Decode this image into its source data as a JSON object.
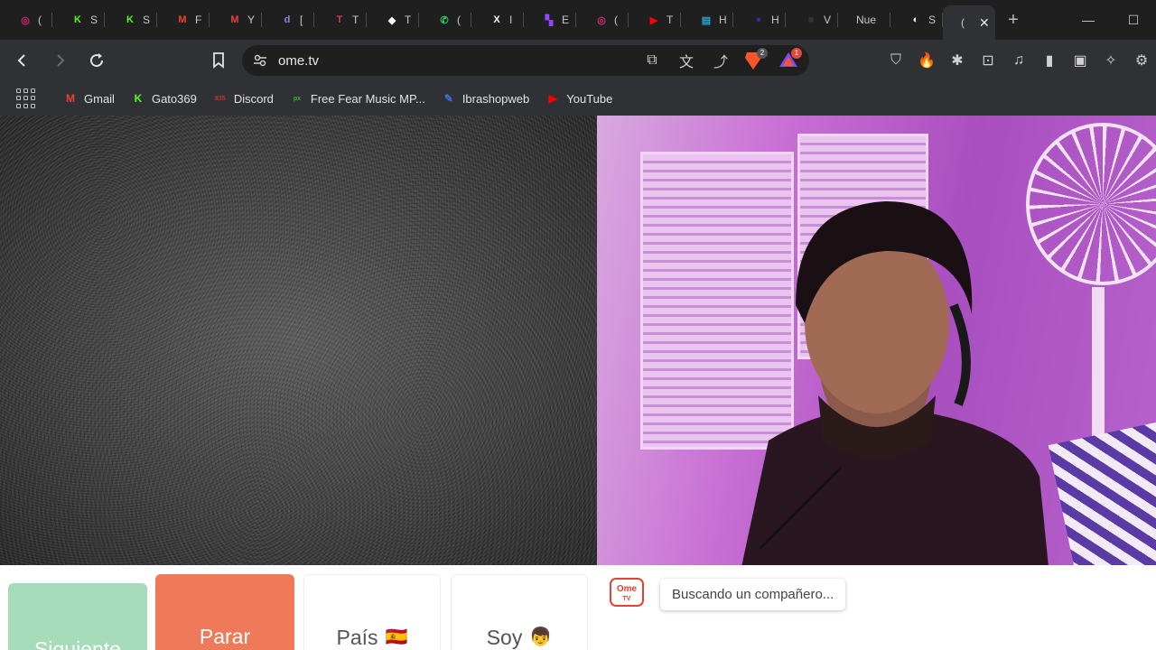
{
  "tabs": [
    {
      "title": "(",
      "icon": "instagram-icon",
      "color": "#d62976"
    },
    {
      "title": "S",
      "icon": "kick-icon",
      "color": "#53fc18"
    },
    {
      "title": "S",
      "icon": "kick-icon",
      "color": "#53fc18"
    },
    {
      "title": "F",
      "icon": "gmail-icon",
      "color": "#ea4335"
    },
    {
      "title": "Y",
      "icon": "gmail-icon",
      "color": "#ea4335"
    },
    {
      "title": "[",
      "icon": "d-icon",
      "color": "#9b7de0"
    },
    {
      "title": "T",
      "icon": "tiktok-like-icon",
      "color": "#e5334c"
    },
    {
      "title": "T",
      "icon": "diamond-icon",
      "color": "#ffffff"
    },
    {
      "title": "(",
      "icon": "whatsapp-icon",
      "color": "#25d366"
    },
    {
      "title": "I",
      "icon": "x-icon",
      "color": "#ffffff"
    },
    {
      "title": "E",
      "icon": "twitch-icon",
      "color": "#9146ff"
    },
    {
      "title": "(",
      "icon": "instagram-icon",
      "color": "#d62976"
    },
    {
      "title": "T",
      "icon": "youtube-icon",
      "color": "#ff0000"
    },
    {
      "title": "H",
      "icon": "app-icon",
      "color": "#2aa3d9"
    },
    {
      "title": "H",
      "icon": "circle-icon",
      "color": "#3b2a9a"
    },
    {
      "title": "V",
      "icon": "dark-icon",
      "color": "#333333"
    },
    {
      "title": "Nue",
      "icon": "",
      "color": ""
    },
    {
      "title": "S",
      "icon": "github-icon",
      "color": "#ffffff"
    },
    {
      "title": "(",
      "icon": "",
      "color": "",
      "active": true
    }
  ],
  "toolbar": {
    "url": "ome.tv",
    "shields_badge": "2",
    "rewards_badge": "1"
  },
  "bookmarks": [
    {
      "label": "Gmail",
      "icon": "gmail-icon",
      "color": "#ea4335",
      "glyph": "M"
    },
    {
      "label": "Gato369",
      "icon": "kick-icon",
      "color": "#53fc18",
      "glyph": "K"
    },
    {
      "label": "Discord",
      "icon": "discord-icon",
      "color": "#c0392b",
      "glyph": "835"
    },
    {
      "label": "Free Fear Music MP...",
      "icon": "px-icon",
      "color": "#3eb13e",
      "glyph": "px"
    },
    {
      "label": "Ibrashopweb",
      "icon": "shop-icon",
      "color": "#3c6fd8",
      "glyph": "✎"
    },
    {
      "label": "YouTube",
      "icon": "youtube-icon",
      "color": "#ff0000",
      "glyph": "▶"
    }
  ],
  "controls": {
    "next_label": "Siguiente",
    "stop_label": "Parar",
    "country_label": "País",
    "country_flag": "🇪🇸",
    "gender_label": "Soy",
    "gender_emoji": "👦"
  },
  "chat": {
    "logo_top": "Ome",
    "logo_bottom": "TV",
    "status": "Buscando un compañero..."
  }
}
